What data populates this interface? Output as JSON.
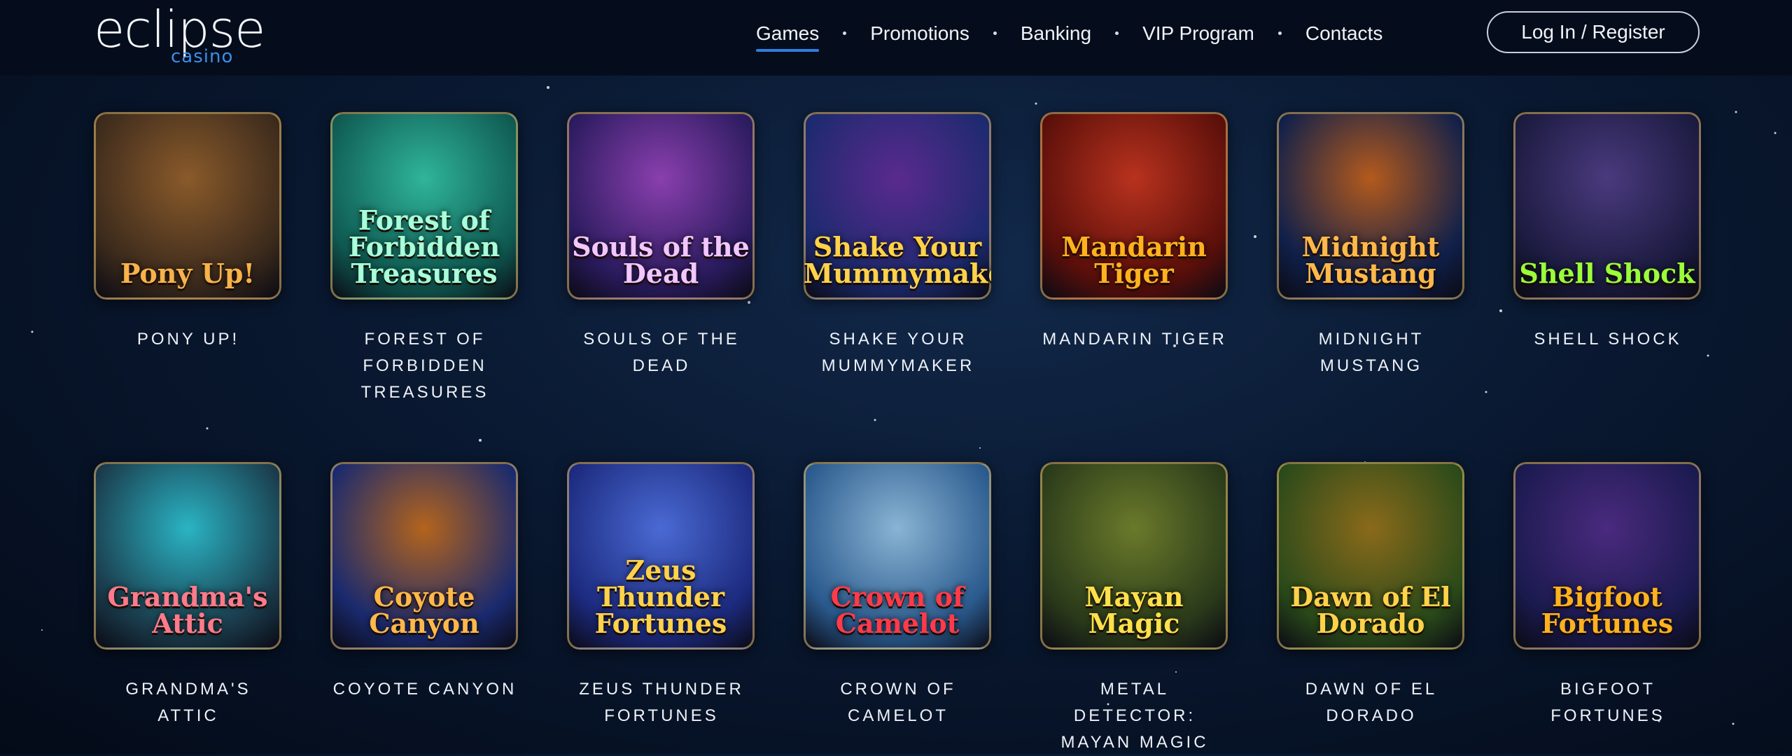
{
  "brand": {
    "word": "eclipse",
    "sub": "casino"
  },
  "nav": [
    {
      "label": "Games",
      "active": true
    },
    {
      "label": "Promotions"
    },
    {
      "label": "Banking"
    },
    {
      "label": "VIP Program"
    },
    {
      "label": "Contacts"
    }
  ],
  "login_label": "Log In / Register",
  "games": [
    {
      "name": "PONY UP!",
      "art": "Pony Up!",
      "c1": "#3b2a1c",
      "c2": "#8a5a2a",
      "ink": "#f7b24a"
    },
    {
      "name": "FOREST OF FORBIDDEN TREASURES",
      "art": "Forest of Forbidden Treasures",
      "c1": "#0f5a52",
      "c2": "#2fb59a",
      "ink": "#a8ffd9"
    },
    {
      "name": "SOULS OF THE DEAD",
      "art": "Souls of the Dead",
      "c1": "#2a1b5e",
      "c2": "#8a3fae",
      "ink": "#f2c6ff"
    },
    {
      "name": "SHAKE YOUR MUMMYMAKER",
      "art": "Shake Your Mummymaker",
      "c1": "#1c2a6e",
      "c2": "#5a2a8e",
      "ink": "#ffd24a"
    },
    {
      "name": "MANDARIN TIGER",
      "art": "Mandarin Tiger",
      "c1": "#5a0f0a",
      "c2": "#b8321e",
      "ink": "#ffb21e"
    },
    {
      "name": "MIDNIGHT MUSTANG",
      "art": "Midnight Mustang",
      "c1": "#10204a",
      "c2": "#b45a1c",
      "ink": "#ffb84a"
    },
    {
      "name": "SHELL SHOCK",
      "art": "Shell Shock",
      "c1": "#1a1a3e",
      "c2": "#4a3a7e",
      "ink": "#9aff3a"
    },
    {
      "name": "GRANDMA'S ATTIC",
      "art": "Grandma's Attic",
      "c1": "#1a3a4a",
      "c2": "#2ab4c4",
      "ink": "#ff7a8a"
    },
    {
      "name": "COYOTE CANYON",
      "art": "Coyote Canyon",
      "c1": "#1a2a6e",
      "c2": "#b4641c",
      "ink": "#ffb84a"
    },
    {
      "name": "ZEUS THUNDER FORTUNES",
      "art": "Zeus Thunder Fortunes",
      "c1": "#1c2a7e",
      "c2": "#4a6ad4",
      "ink": "#ffd24a"
    },
    {
      "name": "CROWN OF CAMELOT",
      "art": "Crown of Camelot",
      "c1": "#2a5a8e",
      "c2": "#8ab4d4",
      "ink": "#ff3a4a"
    },
    {
      "name": "METAL DETECTOR: MAYAN MAGIC",
      "art": "Mayan Magic",
      "c1": "#2a3a1a",
      "c2": "#6a7a2a",
      "ink": "#ffe04a"
    },
    {
      "name": "DAWN OF EL DORADO",
      "art": "Dawn of El Dorado",
      "c1": "#2a4a1a",
      "c2": "#8a6a1a",
      "ink": "#ffd24a"
    },
    {
      "name": "BIGFOOT FORTUNES",
      "art": "Bigfoot Fortunes",
      "c1": "#1a1a4e",
      "c2": "#4a2a7e",
      "ink": "#ffb21e"
    }
  ]
}
